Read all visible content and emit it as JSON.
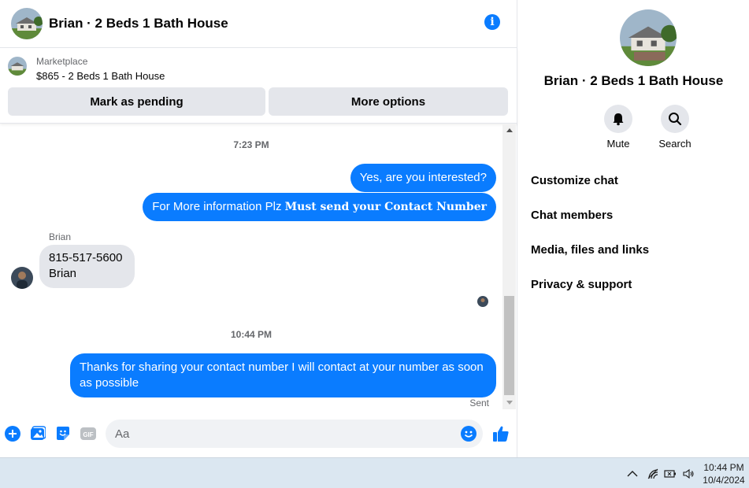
{
  "header": {
    "title": "Brian · 2 Beds 1 Bath House"
  },
  "marketplace": {
    "label": "Marketplace",
    "listing": "$865 - 2 Beds 1 Bath House",
    "pending_label": "Mark as pending",
    "more_label": "More options"
  },
  "conversation": {
    "time1": "7:23 PM",
    "msg1": "Yes, are you interested?",
    "msg2_plain": "For More information Plz ",
    "msg2_bold": "Must send your Contact Number",
    "sender": "Brian",
    "incoming_line1": "815-517-5600",
    "incoming_line2": "Brian",
    "time2": "10:44 PM",
    "msg3": "Thanks for sharing your contact number I will contact at your number as soon as possible",
    "status": "Sent"
  },
  "composer": {
    "placeholder": "Aa"
  },
  "sidebar": {
    "title": "Brian · 2 Beds 1 Bath House",
    "mute_label": "Mute",
    "search_label": "Search",
    "items": [
      "Customize chat",
      "Chat members",
      "Media, files and links",
      "Privacy & support"
    ]
  },
  "taskbar": {
    "time": "10:44 PM",
    "date": "10/4/2024"
  },
  "colors": {
    "accent": "#0a7cff",
    "bubble_in": "#e4e6eb",
    "button_bg": "#e4e6eb"
  }
}
